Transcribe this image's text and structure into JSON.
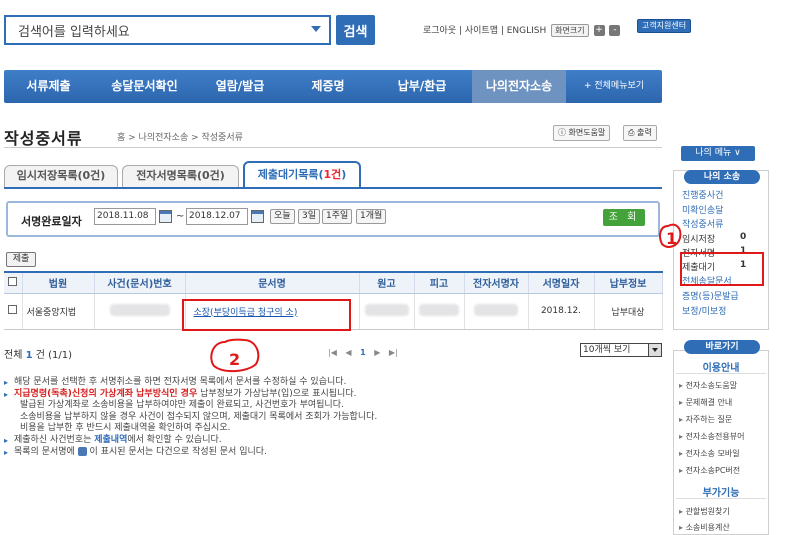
{
  "header": {
    "search_placeholder": "검색어를 입력하세요",
    "search_button": "검색",
    "util_links": "로그아웃 | 사이트맵 | ENGLISH",
    "zoom_label": "화면크기",
    "zoom_in": "+",
    "zoom_out": "-",
    "help_center": "고객지원센터"
  },
  "nav": {
    "items": [
      "서류제출",
      "송달문서확인",
      "열람/발급",
      "제증명",
      "납부/환급",
      "나의전자소송"
    ],
    "more": "+ 전체메뉴보기"
  },
  "page": {
    "title": "작성중서류",
    "breadcrumb": "홈 > 나의전자소송 > 작성중서류",
    "help_button": "화면도움말",
    "print_button": "출력"
  },
  "tabs": [
    {
      "label": "임시저장목록(0건)"
    },
    {
      "label": "전자서명목록(0건)"
    },
    {
      "label_pre": "제출대기목록(",
      "label_count": "1건",
      "label_post": ")"
    }
  ],
  "filter": {
    "label": "서명완료일자",
    "date_from": "2018.11.08",
    "sep": "~",
    "date_to": "2018.12.07",
    "quick": [
      "오늘",
      "3일",
      "1주일",
      "1개월"
    ],
    "query_button": "조 회"
  },
  "table": {
    "submit_button": "제출",
    "headers": [
      "",
      "법원",
      "사건(문서)번호",
      "문서명",
      "원고",
      "피고",
      "전자서명자",
      "서명일자",
      "납부정보"
    ],
    "rows": [
      {
        "court": "서울중앙지법",
        "case_no": "",
        "doc_name": "소장(부당이득금 청구의 소)",
        "plaintiff": "",
        "defendant": "",
        "signer": "",
        "date": "2018.12.",
        "payment": "납부대상"
      }
    ],
    "total_pre": "전체",
    "total_count": "1",
    "total_post": "건 (1/1)",
    "pager_prev": "|◀  ◀",
    "pager_current": "1",
    "pager_next": "▶  ▶|",
    "page_size": "10개씩 보기"
  },
  "notes": {
    "n1": "해당 문서를 선택한 후 서명취소를 하면 전자서명 목록에서 문서를 수정하실 수 있습니다.",
    "n2_red": "지급명령(독촉)신청의 가상계좌 납부방식인 경우",
    "n2_rest": " 납부정보가 가상납부(입)으로 표시됩니다.",
    "n2_l2": "발급된 가상계좌로 소송비용을 납부하여야만 제출이 완료되고, 사건번호가 부여됩니다.",
    "n2_l3": "소송비용을 납부하지 않을 경우 사건이 접수되지 않으며, 제출대기 목록에서 조회가 가능합니다.",
    "n2_l4": "비용을 납부한 후 반드시 제출내역을 확인하여 주십시오.",
    "n3_pre": "제출하신 사건번호는 ",
    "n3_link": "제출내역",
    "n3_post": "에서 확인할 수 있습니다.",
    "n4_pre": "목록의 문서명에 ",
    "n4_post": " 이 표시된 문서는 다건으로 작성된 문서 입니다."
  },
  "sidebar": {
    "my_menu": "나의 메뉴 ∨",
    "section_title": "나의 소송",
    "items": [
      {
        "label": "진행중사건"
      },
      {
        "label": "미확인송달"
      },
      {
        "label": "작성중서류"
      },
      {
        "label": "임시저장",
        "count": "0"
      },
      {
        "label": "전자서명",
        "count": "1"
      },
      {
        "label": "제출대기",
        "count": "1"
      },
      {
        "label": "전체송달문서"
      },
      {
        "label": "증명(등)문발급"
      },
      {
        "label": "보정/미보정"
      }
    ],
    "quick_title": "바로가기",
    "guide_title": "이용안내",
    "guide_links": [
      "전자소송도움말",
      "문제해결 안내",
      "자주하는 질문",
      "전자소송전용뷰어",
      "전자소송 모바일",
      "전자소송PC버전"
    ],
    "extra_title": "부가기능",
    "extra_links": [
      "관할법원찾기",
      "소송비용계산"
    ]
  },
  "annotations": {
    "mark1": "1",
    "mark2": "2",
    "color": "#e01818"
  }
}
